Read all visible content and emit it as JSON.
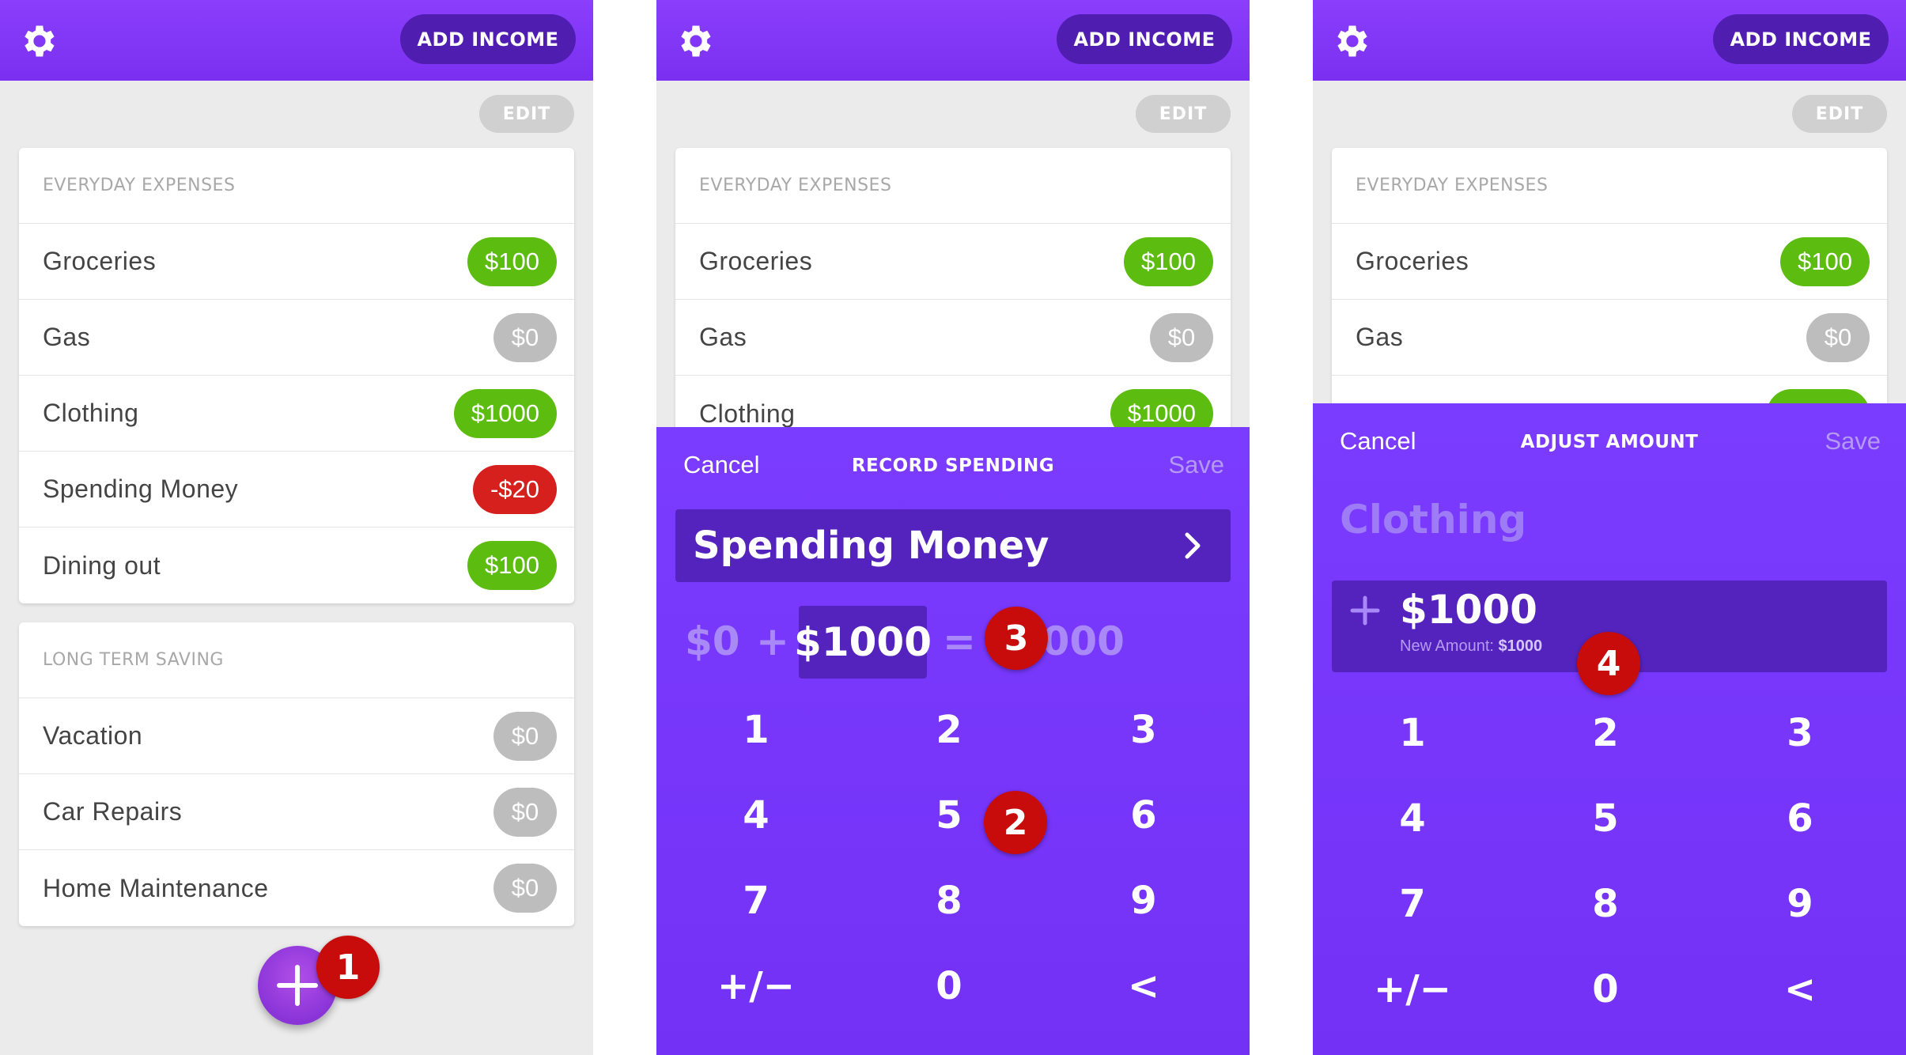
{
  "colors": {
    "header_purple": "#8a3ffc",
    "add_income_bg": "#4f1db0",
    "sheet_purple": "#7a3cff",
    "field_dark": "#5423bd",
    "pill_green": "#5cbc10",
    "pill_grey": "#bdbdbd",
    "pill_red": "#d5201d",
    "badge_red": "#c80c0c",
    "background": "#ebebeb"
  },
  "header": {
    "settings_icon": "gear-icon",
    "add_income_label": "ADD INCOME"
  },
  "list": {
    "edit_label": "EDIT",
    "everyday": {
      "title": "EVERYDAY EXPENSES",
      "items": [
        {
          "label": "Groceries",
          "amount": "$100",
          "status": "green"
        },
        {
          "label": "Gas",
          "amount": "$0",
          "status": "grey"
        },
        {
          "label": "Clothing",
          "amount": "$1000",
          "status": "green"
        },
        {
          "label": "Spending Money",
          "amount": "-$20",
          "status": "red"
        },
        {
          "label": "Dining out",
          "amount": "$100",
          "status": "green"
        }
      ]
    },
    "longterm": {
      "title": "LONG TERM SAVING",
      "items": [
        {
          "label": "Vacation",
          "amount": "$0",
          "status": "grey"
        },
        {
          "label": "Car Repairs",
          "amount": "$0",
          "status": "grey"
        },
        {
          "label": "Home Maintenance",
          "amount": "$0",
          "status": "grey"
        }
      ]
    },
    "fab_icon": "plus-icon"
  },
  "record_spending": {
    "cancel_label": "Cancel",
    "title": "RECORD SPENDING",
    "save_label": "Save",
    "category": "Spending Money",
    "chevron_icon": "chevron-right-icon",
    "current": "$0",
    "plus": "+",
    "entered": "$1000",
    "equals": "=",
    "result": "$1000"
  },
  "adjust_amount": {
    "cancel_label": "Cancel",
    "title": "ADJUST AMOUNT",
    "save_label": "Save",
    "category": "Clothing",
    "entered": "$1000",
    "new_amount_label": "New Amount:",
    "new_amount_value": "$1000"
  },
  "keypad": {
    "keys": [
      "1",
      "2",
      "3",
      "4",
      "5",
      "6",
      "7",
      "8",
      "9",
      "+/−",
      "0",
      "<"
    ]
  },
  "badges": {
    "b1": "1",
    "b2": "2",
    "b3": "3",
    "b4": "4"
  }
}
